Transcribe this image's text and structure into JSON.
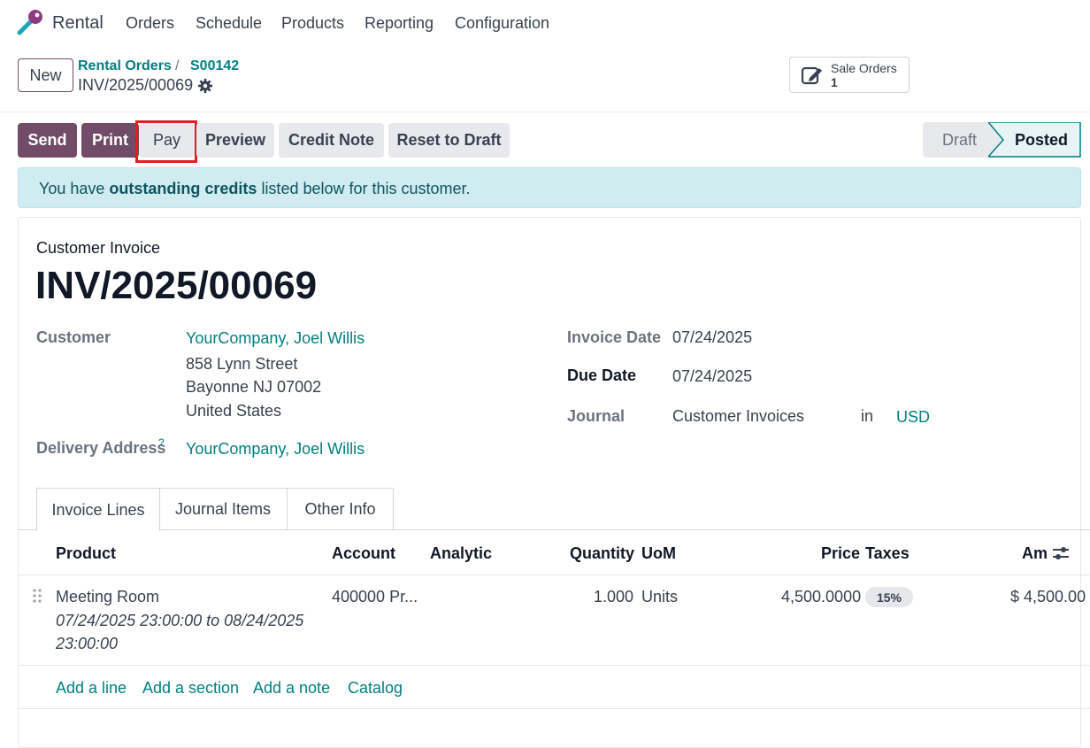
{
  "nav": {
    "app_name": "Rental",
    "menu": [
      "Orders",
      "Schedule",
      "Products",
      "Reporting",
      "Configuration"
    ]
  },
  "control_panel": {
    "new_label": "New",
    "breadcrumbs": [
      "Rental Orders",
      "S00142"
    ],
    "breadcrumb_sep": "/",
    "current_record": "INV/2025/00069",
    "smart_button": {
      "label": "Sale Orders",
      "count": "1"
    }
  },
  "actions": {
    "send": "Send",
    "print": "Print",
    "pay": "Pay",
    "preview": "Preview",
    "credit_note": "Credit Note",
    "reset_to_draft": "Reset to Draft"
  },
  "status": {
    "draft": "Draft",
    "posted": "Posted"
  },
  "alert": {
    "prefix": "You have ",
    "bold": "outstanding credits",
    "suffix": " listed below for this customer."
  },
  "invoice": {
    "type_label": "Customer Invoice",
    "number": "INV/2025/00069",
    "customer_label": "Customer",
    "customer_name": "YourCompany, Joel Willis",
    "address_line1": "858 Lynn Street",
    "address_line2": "Bayonne NJ 07002",
    "address_line3": "United States",
    "delivery_label": "Delivery Address",
    "delivery_help": "?",
    "delivery_name": "YourCompany, Joel Willis",
    "invoice_date_label": "Invoice Date",
    "invoice_date": "07/24/2025",
    "due_date_label": "Due Date",
    "due_date": "07/24/2025",
    "journal_label": "Journal",
    "journal": "Customer Invoices",
    "in_label": "in",
    "currency": "USD"
  },
  "tabs": [
    "Invoice Lines",
    "Journal Items",
    "Other Info"
  ],
  "table": {
    "headers": {
      "product": "Product",
      "account": "Account",
      "analytic": "Analytic",
      "quantity": "Quantity",
      "uom": "UoM",
      "price": "Price",
      "taxes": "Taxes",
      "amount": "Am"
    },
    "rows": [
      {
        "product": "Meeting Room",
        "desc_line1": "07/24/2025 23:00:00 to 08/24/2025",
        "desc_line2": "23:00:00",
        "account": "400000 Pr...",
        "quantity": "1.000",
        "uom": "Units",
        "price": "4,500.0000",
        "tax": "15%",
        "amount": "$ 4,500.00"
      }
    ],
    "add_links": [
      "Add a line",
      "Add a section",
      "Add a note",
      "Catalog"
    ]
  },
  "colors": {
    "brand": "#714B67",
    "link": "#017E84",
    "alert_bg": "#d1ecf1",
    "highlight": "#e11d24"
  }
}
